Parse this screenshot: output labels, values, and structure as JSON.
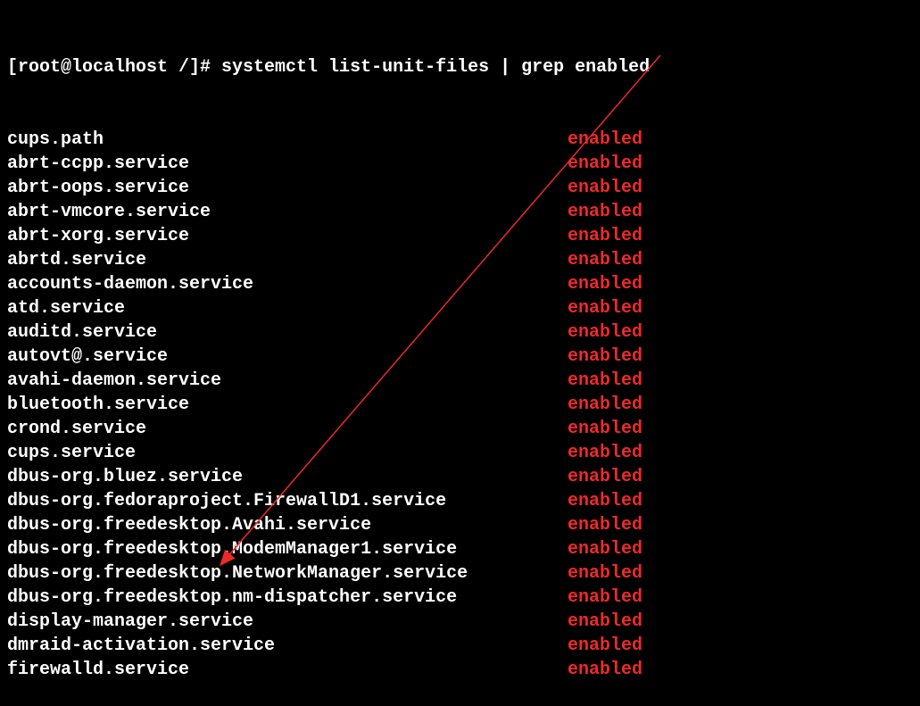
{
  "prompt": "[root@localhost /]# systemctl list-unit-files | grep enabled",
  "units": [
    {
      "name": "cups.path",
      "status": "enabled"
    },
    {
      "name": "abrt-ccpp.service",
      "status": "enabled"
    },
    {
      "name": "abrt-oops.service",
      "status": "enabled"
    },
    {
      "name": "abrt-vmcore.service",
      "status": "enabled"
    },
    {
      "name": "abrt-xorg.service",
      "status": "enabled"
    },
    {
      "name": "abrtd.service",
      "status": "enabled"
    },
    {
      "name": "accounts-daemon.service",
      "status": "enabled"
    },
    {
      "name": "atd.service",
      "status": "enabled"
    },
    {
      "name": "auditd.service",
      "status": "enabled"
    },
    {
      "name": "autovt@.service",
      "status": "enabled"
    },
    {
      "name": "avahi-daemon.service",
      "status": "enabled"
    },
    {
      "name": "bluetooth.service",
      "status": "enabled"
    },
    {
      "name": "crond.service",
      "status": "enabled"
    },
    {
      "name": "cups.service",
      "status": "enabled"
    },
    {
      "name": "dbus-org.bluez.service",
      "status": "enabled"
    },
    {
      "name": "dbus-org.fedoraproject.FirewallD1.service",
      "status": "enabled"
    },
    {
      "name": "dbus-org.freedesktop.Avahi.service",
      "status": "enabled"
    },
    {
      "name": "dbus-org.freedesktop.ModemManager1.service",
      "status": "enabled"
    },
    {
      "name": "dbus-org.freedesktop.NetworkManager.service",
      "status": "enabled"
    },
    {
      "name": "dbus-org.freedesktop.nm-dispatcher.service",
      "status": "enabled"
    },
    {
      "name": "display-manager.service",
      "status": "enabled"
    },
    {
      "name": "dmraid-activation.service",
      "status": "enabled"
    },
    {
      "name": "firewalld.service",
      "status": "enabled"
    }
  ],
  "arrow": {
    "startX": 740,
    "startY": 62,
    "endX": 248,
    "endY": 632
  }
}
